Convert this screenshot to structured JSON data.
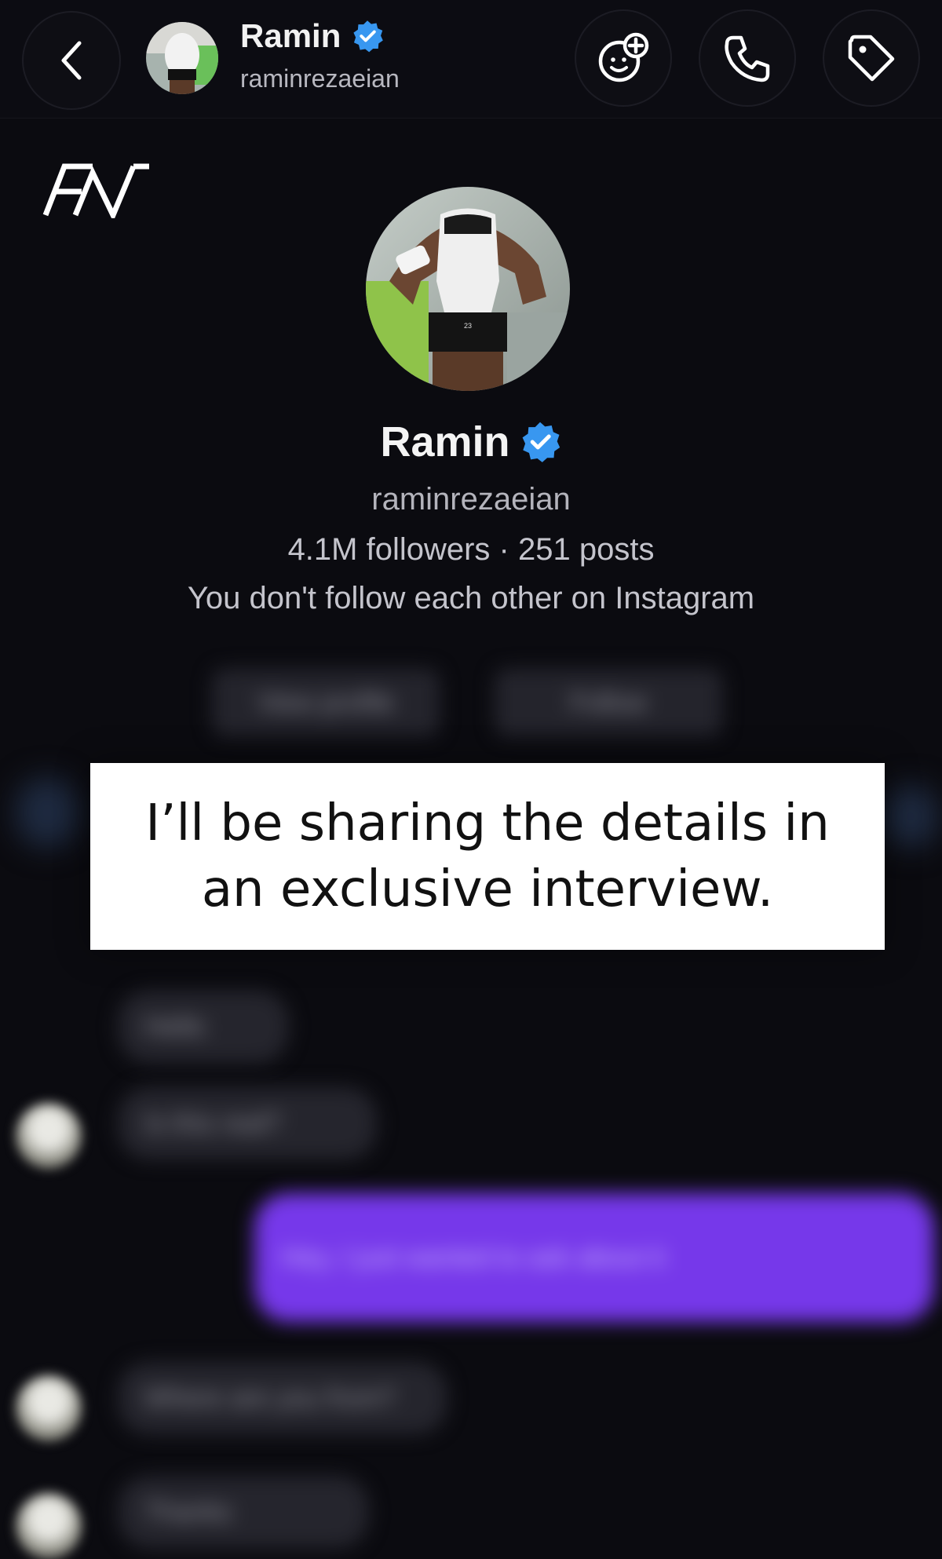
{
  "header": {
    "name": "Ramin",
    "username": "raminrezaeian",
    "back_icon": "chevron-left-icon",
    "effects_icon": "sticker-add-icon",
    "call_icon": "phone-icon",
    "tag_icon": "tag-icon"
  },
  "watermark": {
    "text": "FN"
  },
  "profile": {
    "name": "Ramin",
    "username": "raminrezaeian",
    "stats": "4.1M followers · 251 posts",
    "relation": "You don't follow each other on Instagram",
    "view_profile_label": "View profile",
    "follow_label": "Follow"
  },
  "overlay": {
    "text": "I’ll be sharing the details in an exclusive interview."
  },
  "messages": [
    {
      "sender": "them",
      "text": "Hello"
    },
    {
      "sender": "them",
      "text": "Is this real?"
    },
    {
      "sender": "me",
      "text": "Hey, I just wanted to ask about it"
    },
    {
      "sender": "them",
      "text": "Where are you from?"
    },
    {
      "sender": "them",
      "text": "Thanks"
    }
  ],
  "colors": {
    "background": "#0b0b10",
    "verified": "#3897f0",
    "sent_bubble": "#7638ea",
    "received_bubble": "#25252d"
  }
}
